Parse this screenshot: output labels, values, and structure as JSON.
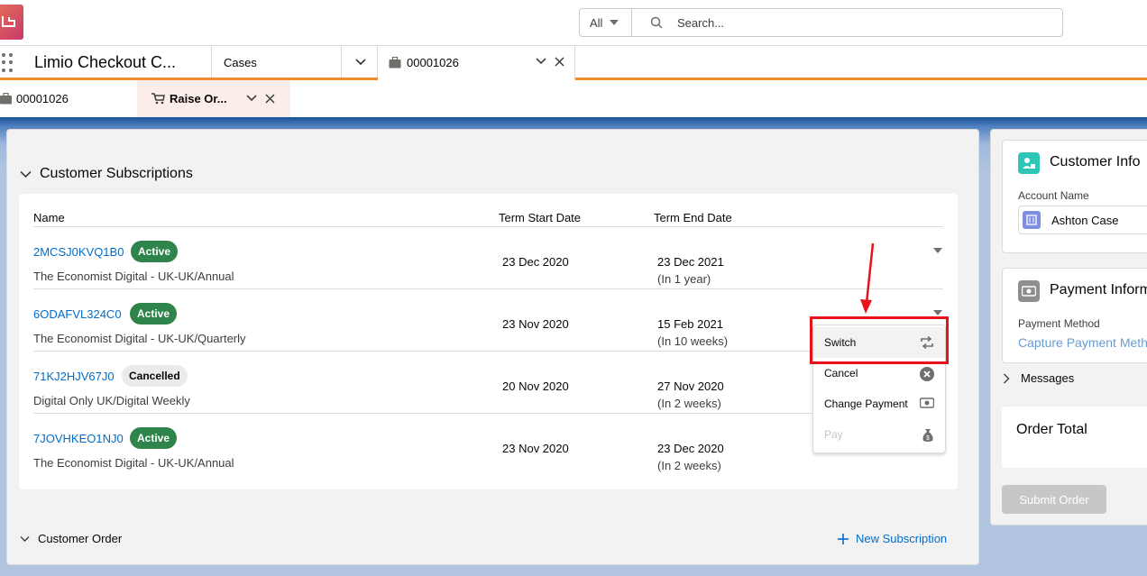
{
  "global_header": {
    "search_scope": "All",
    "search_placeholder": "Search..."
  },
  "nav": {
    "app_name": "Limio Checkout C...",
    "tabs": [
      {
        "label": "Cases"
      },
      {
        "label": "00001026"
      }
    ]
  },
  "subtabs": [
    {
      "label": "00001026"
    },
    {
      "label": "Raise Or..."
    }
  ],
  "subscriptions": {
    "title": "Customer Subscriptions",
    "columns": [
      "Name",
      "Term Start Date",
      "Term End Date"
    ],
    "rows": [
      {
        "id": "2MCSJ0KVQ1B0",
        "status": "Active",
        "product": "The Economist Digital - UK-UK/Annual",
        "start": "23 Dec 2020",
        "end": "23 Dec 2021",
        "relative": "(In 1 year)"
      },
      {
        "id": "6ODAFVL324C0",
        "status": "Active",
        "product": "The Economist Digital - UK-UK/Quarterly",
        "start": "23 Nov 2020",
        "end": "15 Feb 2021",
        "relative": "(In 10 weeks)"
      },
      {
        "id": "71KJ2HJV67J0",
        "status": "Cancelled",
        "product": "Digital Only UK/Digital Weekly",
        "start": "20 Nov 2020",
        "end": "27 Nov 2020",
        "relative": "(In 2 weeks)"
      },
      {
        "id": "7JOVHKEO1NJ0",
        "status": "Active",
        "product": "The Economist Digital - UK-UK/Annual",
        "start": "23 Nov 2020",
        "end": "23 Dec 2020",
        "relative": "(In 2 weeks)"
      }
    ]
  },
  "row_menu": {
    "items": [
      {
        "label": "Switch",
        "icon": "switch-icon"
      },
      {
        "label": "Cancel",
        "icon": "cancel-icon"
      },
      {
        "label": "Change Payment",
        "icon": "payment-icon"
      },
      {
        "label": "Pay",
        "icon": "money-bag-icon",
        "disabled": true
      }
    ]
  },
  "customer_order": {
    "title": "Customer Order",
    "new_subscription": "New Subscription"
  },
  "customer_info": {
    "title": "Customer Info",
    "account_label": "Account Name",
    "account_value": "Ashton Case"
  },
  "payment_info": {
    "title": "Payment Inform",
    "method_label": "Payment Method",
    "method_value": "Capture Payment Meth"
  },
  "messages": {
    "label": "Messages"
  },
  "order_total": {
    "label": "Order Total"
  },
  "submit": {
    "label": "Submit Order"
  },
  "colors": {
    "active_badge": "#2e844a",
    "link": "#006dcc",
    "nav_accent": "#f28b30",
    "highlight": "#e8121a"
  }
}
